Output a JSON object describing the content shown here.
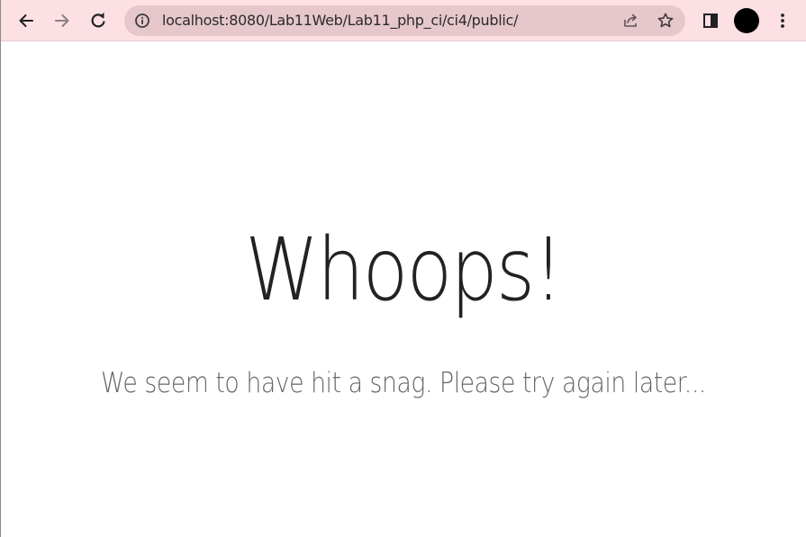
{
  "browser": {
    "url": "localhost:8080/Lab11Web/Lab11_php_ci/ci4/public/",
    "icons": {
      "back": "arrow-left-icon",
      "forward": "arrow-right-icon",
      "reload": "reload-icon",
      "site_info": "info-icon",
      "share": "share-icon",
      "bookmark": "star-icon",
      "side_panel": "side-panel-icon",
      "profile": "avatar",
      "menu": "kebab-menu-icon"
    },
    "colors": {
      "toolbar_bg": "#fde0e4",
      "omnibox_bg": "#e6c7cc"
    }
  },
  "page": {
    "heading": "Whoops!",
    "message": "We seem to have hit a snag. Please try again later..."
  }
}
